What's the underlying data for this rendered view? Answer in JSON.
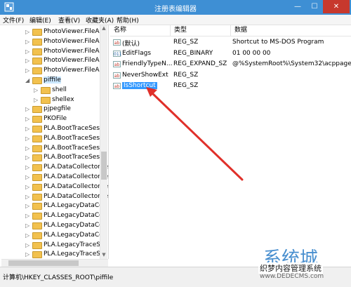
{
  "window": {
    "title": "注册表编辑器",
    "min": "—",
    "max": "☐",
    "close": "✕"
  },
  "menu": [
    "文件(F)",
    "编辑(E)",
    "查看(V)",
    "收藏夹(A)",
    "帮助(H)"
  ],
  "tree": {
    "items": [
      {
        "label": "PhotoViewer.FileAss",
        "level": 1
      },
      {
        "label": "PhotoViewer.FileAss",
        "level": 1
      },
      {
        "label": "PhotoViewer.FileAss",
        "level": 1
      },
      {
        "label": "PhotoViewer.FileAss",
        "level": 1
      },
      {
        "label": "PhotoViewer.FileAss",
        "level": 1
      },
      {
        "label": "piffile",
        "level": 1,
        "expanded": true,
        "selected": true
      },
      {
        "label": "shell",
        "level": 2
      },
      {
        "label": "shellex",
        "level": 2
      },
      {
        "label": "pjpegfile",
        "level": 1
      },
      {
        "label": "PKOFile",
        "level": 1
      },
      {
        "label": "PLA.BootTraceSessi",
        "level": 1
      },
      {
        "label": "PLA.BootTraceSessi",
        "level": 1
      },
      {
        "label": "PLA.BootTraceSessi",
        "level": 1
      },
      {
        "label": "PLA.BootTraceSessi",
        "level": 1
      },
      {
        "label": "PLA.DataCollectorSe",
        "level": 1
      },
      {
        "label": "PLA.DataCollectorSe",
        "level": 1
      },
      {
        "label": "PLA.DataCollectorSe",
        "level": 1
      },
      {
        "label": "PLA.DataCollectorSe",
        "level": 1
      },
      {
        "label": "PLA.LegacyDataColl",
        "level": 1
      },
      {
        "label": "PLA.LegacyDataColl",
        "level": 1
      },
      {
        "label": "PLA.LegacyDataColl",
        "level": 1
      },
      {
        "label": "PLA.LegacyDataColl",
        "level": 1
      },
      {
        "label": "PLA.LegacyTraceSes",
        "level": 1
      },
      {
        "label": "PLA.LegacyTraceSes",
        "level": 1
      },
      {
        "label": "PLA.LegacyTraceSes",
        "level": 1
      }
    ]
  },
  "list": {
    "headers": {
      "name": "名称",
      "type": "类型",
      "data": "数据"
    },
    "rows": [
      {
        "icon": "ab",
        "name": "(默认)",
        "type": "REG_SZ",
        "data": "Shortcut to MS-DOS Program"
      },
      {
        "icon": "bin",
        "name": "EditFlags",
        "type": "REG_BINARY",
        "data": "01 00 00 00"
      },
      {
        "icon": "ab",
        "name": "FriendlyTypeN...",
        "type": "REG_EXPAND_SZ",
        "data": "@%SystemRoot%\\System32\\acppage.dll"
      },
      {
        "icon": "ab",
        "name": "NeverShowExt",
        "type": "REG_SZ",
        "data": ""
      },
      {
        "icon": "ab",
        "name": "IsShortcut",
        "type": "REG_SZ",
        "data": "",
        "selected": true
      }
    ]
  },
  "status": {
    "path": "计算机\\HKEY_CLASSES_ROOT\\piffile"
  },
  "watermark": {
    "big": "系统城",
    "mid": "织梦内容管理系统",
    "url": "www.DEDECMS.com"
  },
  "colors": {
    "titlebar": "#3e8fd4",
    "close": "#c7382d",
    "selection": "#3399ff",
    "arrow": "#e0302a"
  }
}
